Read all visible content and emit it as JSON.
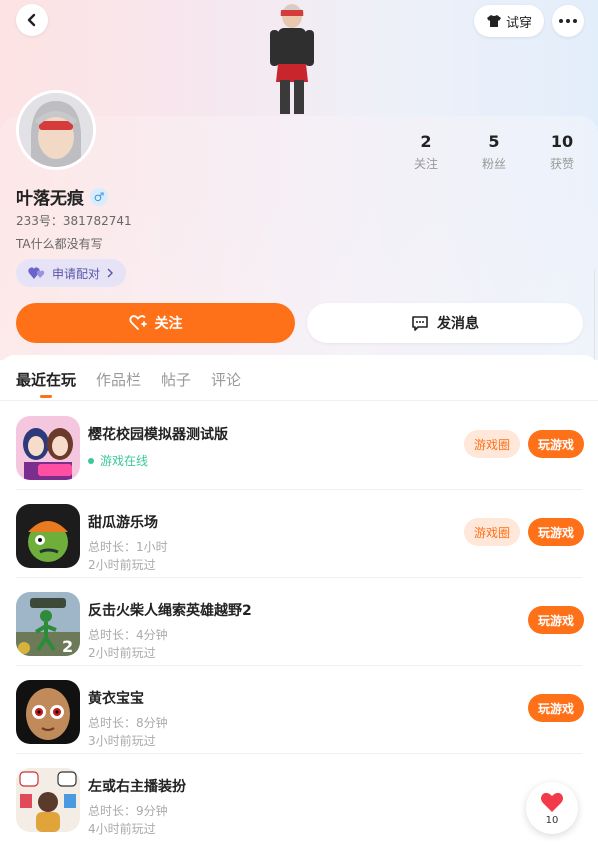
{
  "header": {
    "tryon_label": "试穿"
  },
  "profile": {
    "username": "叶落无痕",
    "gender_symbol": "♂",
    "uid_text": "233号：381782741",
    "bio": "TA什么都没有写",
    "match_label": "申请配对",
    "stats": [
      {
        "value": "2",
        "label": "关注"
      },
      {
        "value": "5",
        "label": "粉丝"
      },
      {
        "value": "10",
        "label": "获赞"
      }
    ],
    "follow_label": "关注",
    "message_label": "发消息"
  },
  "tabs": [
    {
      "label": "最近在玩",
      "active": true
    },
    {
      "label": "作品栏",
      "active": false
    },
    {
      "label": "帖子",
      "active": false
    },
    {
      "label": "评论",
      "active": false
    }
  ],
  "games": [
    {
      "title": "樱花校园模拟器测试版",
      "line1": "游戏在线",
      "line2": "",
      "circle_label": "游戏圈",
      "play_label": "玩游戏",
      "icon": "sakura-school-icon"
    },
    {
      "title": "甜瓜游乐场",
      "line1": "总时长：1小时",
      "line2": "2小时前玩过",
      "circle_label": "游戏圈",
      "play_label": "玩游戏",
      "icon": "melon-playground-icon"
    },
    {
      "title": "反击火柴人绳索英雄越野2",
      "line1": "总时长：4分钟",
      "line2": "2小时前玩过",
      "circle_label": "",
      "play_label": "玩游戏",
      "icon": "stickman-rope-hero-icon"
    },
    {
      "title": "黄衣宝宝",
      "line1": "总时长：8分钟",
      "line2": "3小时前玩过",
      "circle_label": "",
      "play_label": "玩游戏",
      "icon": "baby-in-yellow-icon"
    },
    {
      "title": "左或右主播装扮",
      "line1": "总时长：9分钟",
      "line2": "4小时前玩过",
      "circle_label": "",
      "play_label": "",
      "icon": "left-or-right-dressup-icon"
    }
  ],
  "like_float": {
    "count": "10"
  },
  "colors": {
    "accent": "#ff7119",
    "online": "#3cc79b"
  }
}
